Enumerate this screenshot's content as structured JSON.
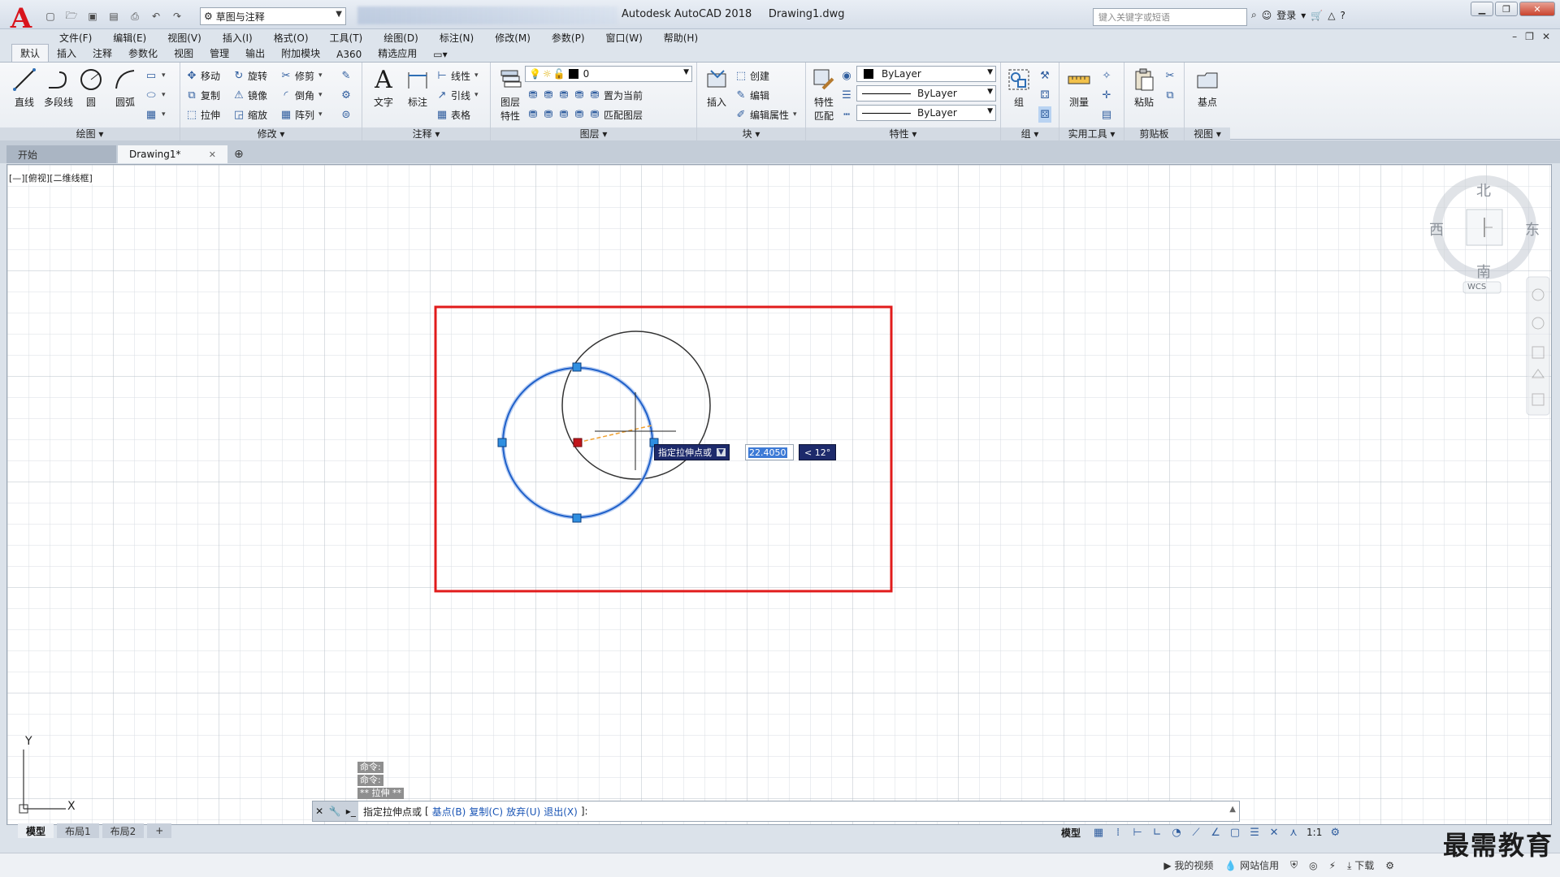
{
  "titlebar": {
    "app_title": "Autodesk AutoCAD 2018",
    "file_name": "Drawing1.dwg",
    "workspace": "草图与注释",
    "help_search_placeholder": "键入关键字或短语",
    "login_label": "登录"
  },
  "menu": [
    "文件(F)",
    "编辑(E)",
    "视图(V)",
    "插入(I)",
    "格式(O)",
    "工具(T)",
    "绘图(D)",
    "标注(N)",
    "修改(M)",
    "参数(P)",
    "窗口(W)",
    "帮助(H)"
  ],
  "ribbon_tabs": [
    "默认",
    "插入",
    "注释",
    "参数化",
    "视图",
    "管理",
    "输出",
    "附加模块",
    "A360",
    "精选应用"
  ],
  "ribbon": {
    "draw": {
      "title": "绘图",
      "line": "直线",
      "polyline": "多段线",
      "circle": "圆",
      "arc": "圆弧"
    },
    "modify": {
      "title": "修改",
      "move": "移动",
      "rotate": "旋转",
      "trim": "修剪",
      "copy": "复制",
      "mirror": "镜像",
      "fillet": "倒角",
      "stretch": "拉伸",
      "scale": "缩放",
      "array": "阵列"
    },
    "annotation": {
      "title": "注释",
      "text": "文字",
      "dimension": "标注",
      "linear": "线性",
      "leader": "引线",
      "table": "表格"
    },
    "layers": {
      "title": "图层",
      "layer_props_1": "图层",
      "layer_props_2": "特性",
      "current_layer": "0",
      "set_current": "置为当前",
      "match_layer": "匹配图层"
    },
    "block": {
      "title": "块",
      "insert": "插入",
      "create": "创建",
      "edit": "编辑",
      "edit_attr": "编辑属性"
    },
    "properties": {
      "title": "特性",
      "match_1": "特性",
      "match_2": "匹配",
      "color": "ByLayer",
      "lineweight": "ByLayer",
      "linetype": "ByLayer"
    },
    "groups": {
      "title": "组",
      "group": "组"
    },
    "utilities": {
      "title": "实用工具",
      "measure": "测量"
    },
    "clipboard": {
      "title": "剪贴板",
      "paste": "粘贴"
    },
    "view": {
      "title": "视图",
      "base": "基点"
    }
  },
  "doc_tabs": [
    "开始",
    "Drawing1*"
  ],
  "viewport_label": "[—][俯视][二维线框]",
  "viewcube": {
    "north": "北",
    "south": "南",
    "east": "东",
    "west": "西",
    "wcs": "WCS"
  },
  "ucs": {
    "x": "X",
    "y": "Y"
  },
  "dynamic_input": {
    "prompt": "指定拉伸点或",
    "distance": "22.4050",
    "angle": "< 12°"
  },
  "command_history": [
    "命令:",
    "命令:",
    "** 拉伸 **"
  ],
  "command_line": {
    "prompt": "指定拉伸点或",
    "options": [
      "基点(B)",
      "复制(C)",
      "放弃(U)",
      "退出(X)"
    ],
    "suffix": "]:"
  },
  "layout_tabs": [
    "模型",
    "布局1",
    "布局2"
  ],
  "status": {
    "model": "模型",
    "scale": "1:1"
  },
  "footer": {
    "video": "我的视频",
    "credit": "网站信用",
    "download": "下载"
  },
  "watermark": "最需教育",
  "colors": {
    "accent": "#d8141c",
    "selection_blue": "#1f60c9",
    "grip": "#2f8fe0",
    "frame_red": "#e11b1b"
  }
}
